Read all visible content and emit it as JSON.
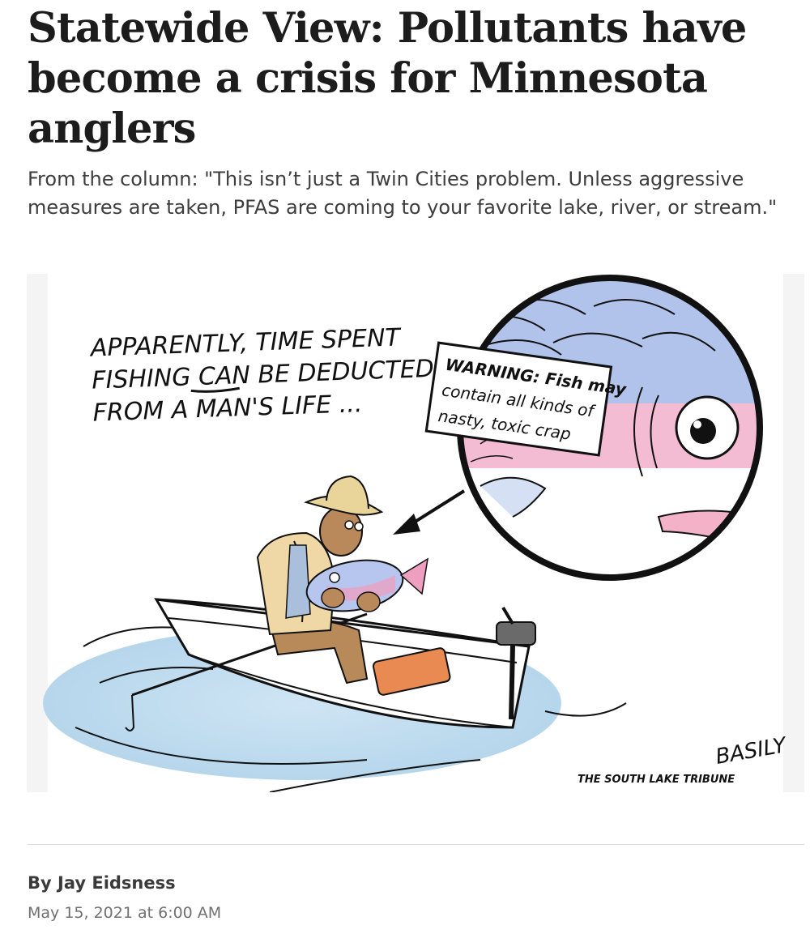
{
  "article": {
    "headline": "Statewide View: Pollutants have become a crisis for Minnesota anglers",
    "dek": "From the column: \"This isn’t just a Twin Cities problem. Unless aggressive measures are taken, PFAS are coming to your favorite lake, river, or stream.\"",
    "byline_prefix": "By ",
    "author": "Jay Eidsness",
    "date": "May 15, 2021 at 6:00 AM"
  },
  "cartoon": {
    "caption_lines": [
      "APPARENTLY, TIME SPENT",
      "FISHING CAN BE DEDUCTED",
      "FROM A MAN'S LIFE ..."
    ],
    "warning_lines": [
      "WARNING: Fish may",
      "contain all kinds of",
      "nasty, toxic crap"
    ],
    "publication_credit": "THE SOUTH LAKE TRIBUNE",
    "artist_signature": "BASILY",
    "colors": {
      "water": "#bcd9ee",
      "fish_blue": "#9fb4e6",
      "fish_pink": "#ee9fc0",
      "hat": "#e9d49a",
      "vest": "#f0d8a6",
      "tackle_box": "#e88a52",
      "panel_background": "#f4f4f4"
    }
  }
}
